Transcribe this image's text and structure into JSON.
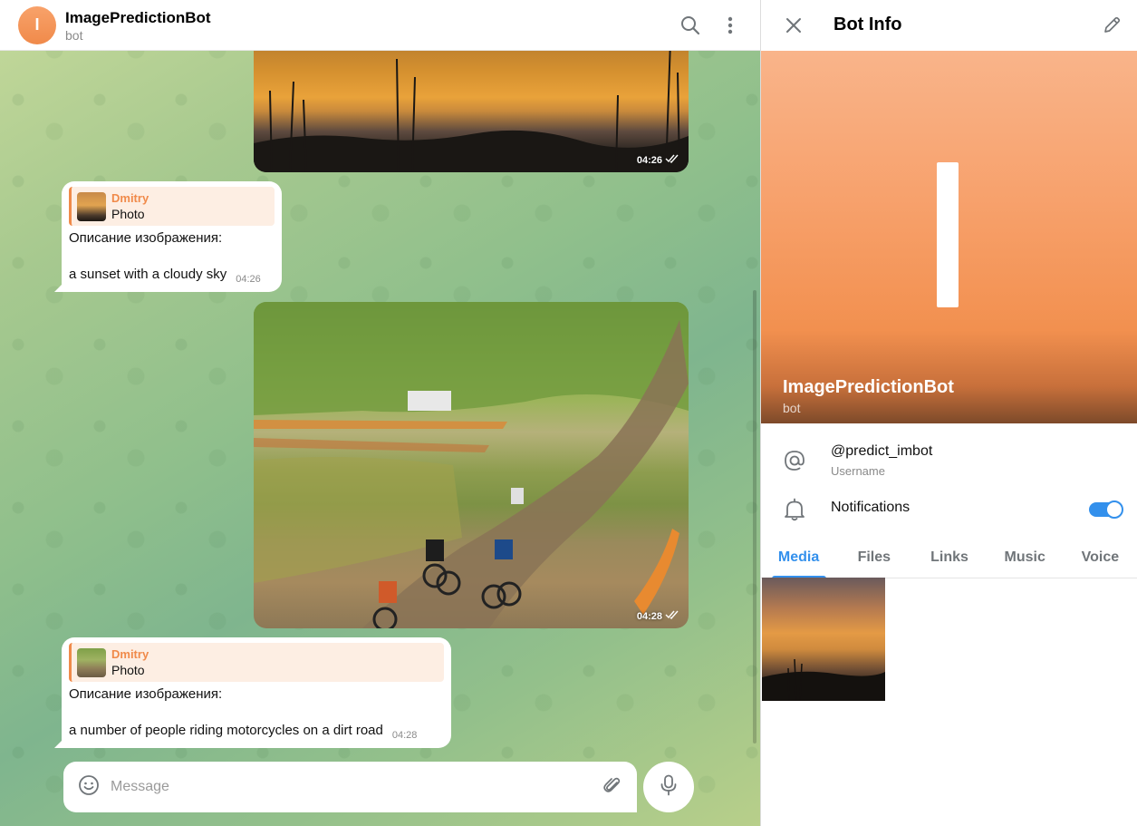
{
  "chat_header": {
    "avatar_letter": "I",
    "title": "ImagePredictionBot",
    "subtitle": "bot"
  },
  "messages": [
    {
      "type": "photo",
      "time": "04:26",
      "status": "read"
    },
    {
      "type": "text",
      "reply": {
        "author": "Dmitry",
        "kind": "Photo"
      },
      "lines": [
        "Описание изображения:",
        "",
        "a sunset with a cloudy sky"
      ],
      "time": "04:26"
    },
    {
      "type": "photo",
      "time": "04:28",
      "status": "read"
    },
    {
      "type": "text",
      "reply": {
        "author": "Dmitry",
        "kind": "Photo"
      },
      "lines": [
        "Описание изображения:",
        "",
        "a number of people riding motorcycles on a dirt road"
      ],
      "time": "04:28"
    }
  ],
  "composer": {
    "placeholder": "Message"
  },
  "panel": {
    "title": "Bot Info",
    "hero": {
      "letter": "I",
      "name": "ImagePredictionBot",
      "subtitle": "bot"
    },
    "username": {
      "value": "@predict_imbot",
      "label": "Username"
    },
    "notifications": {
      "label": "Notifications",
      "enabled": true
    },
    "tabs": [
      "Media",
      "Files",
      "Links",
      "Music",
      "Voice"
    ],
    "active_tab": "Media"
  },
  "colors": {
    "accent": "#3390ec",
    "avatar_orange": "#f08a4a",
    "reply_bg": "#fdeee3"
  }
}
